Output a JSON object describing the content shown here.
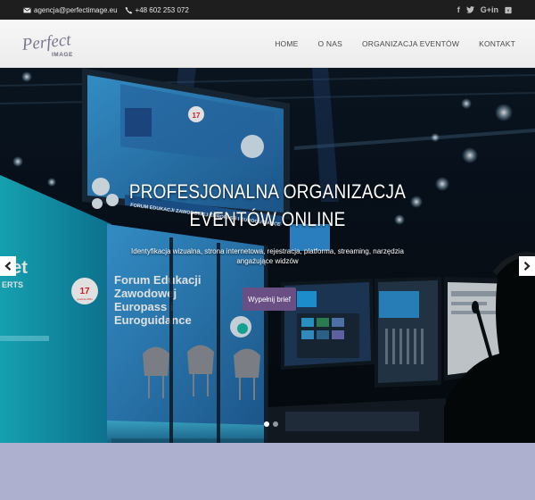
{
  "topbar": {
    "email": "agencja@perfectimage.eu",
    "phone": "+48 602 253 072",
    "social": [
      {
        "icon": "facebook-icon",
        "glyph": "f"
      },
      {
        "icon": "twitter-icon",
        "glyph": "𝕥"
      },
      {
        "icon": "google-plus-icon",
        "glyph": "G+in"
      },
      {
        "icon": "youtube-icon",
        "glyph": "▶"
      }
    ]
  },
  "header": {
    "logo_script": "Perfect",
    "logo_word": "IMAGE",
    "nav": [
      {
        "label": "HOME"
      },
      {
        "label": "O NAS"
      },
      {
        "label": "ORGANIZACJA EVENTÓW"
      },
      {
        "label": "KONTAKT"
      }
    ]
  },
  "hero": {
    "title_line1": "PROFESJONALNA ORGANIZACJA",
    "title_line2": "EVENTÓW ONLINE",
    "subtitle": "Identyfikacja wizualna, strona internetowa, rejestracja, platforma, streaming, narzędzia angażujące widzów",
    "cta_label": "Wypełnij brief",
    "slide_count": 2,
    "active_slide": 1,
    "screen_text": {
      "date_day": "17",
      "date_month": "grudnia 2021",
      "forum_lines": [
        "Forum Edukacji",
        "Zawodowej",
        "Europass i",
        "Euroguidance"
      ],
      "banner": "FORUM EDUKACJI ZAWODOWEJ EUROPASS I EUROGUIDANCE",
      "left_big": "vet",
      "left_small": "ERTS"
    }
  },
  "colors": {
    "topbar_bg": "#1e1e1e",
    "header_bg": "#f2f2f2",
    "cta_bg": "#6a4f84",
    "band_bg": "#aeb0cf",
    "screen_blue": "#2f86c9"
  }
}
